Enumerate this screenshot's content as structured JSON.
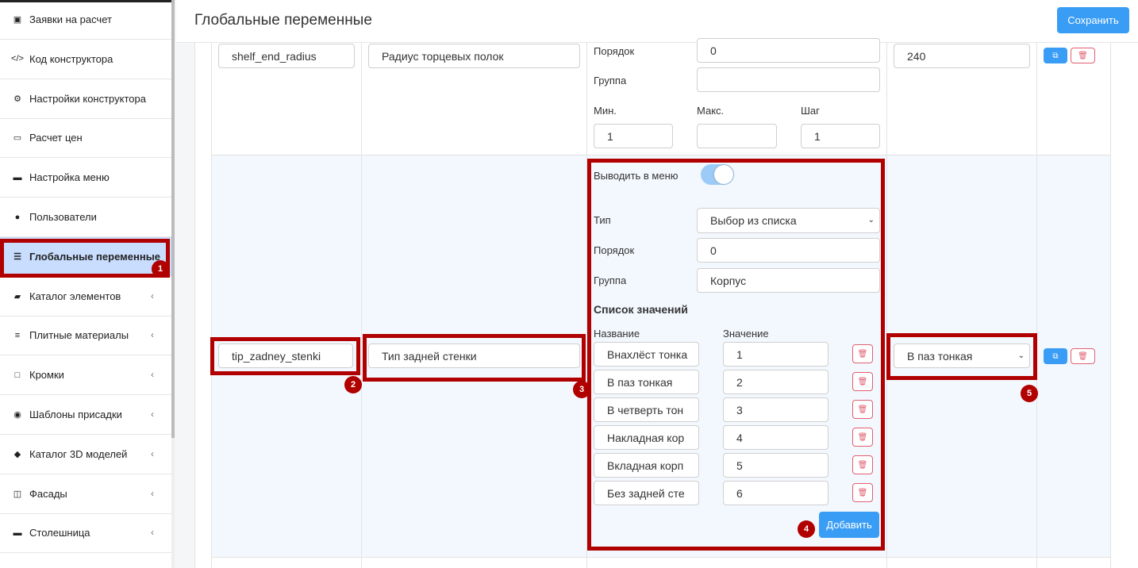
{
  "sidebar": {
    "items": [
      {
        "label": "Заявки на расчет",
        "icon": "clipboard-icon"
      },
      {
        "label": "Код конструктора",
        "icon": "code-icon"
      },
      {
        "label": "Настройки конструктора",
        "icon": "gears-icon"
      },
      {
        "label": "Расчет цен",
        "icon": "money-icon"
      },
      {
        "label": "Настройка меню",
        "icon": "monitor-icon"
      },
      {
        "label": "Пользователи",
        "icon": "user-icon"
      },
      {
        "label": "Глобальные переменные",
        "icon": "list-icon",
        "active": true
      },
      {
        "label": "Каталог элементов",
        "icon": "book-icon",
        "chevron": "‹"
      },
      {
        "label": "Плитные материалы",
        "icon": "bars-icon",
        "chevron": "‹"
      },
      {
        "label": "Кромки",
        "icon": "square-icon",
        "chevron": "‹"
      },
      {
        "label": "Шаблоны присадки",
        "icon": "circle-dot-icon",
        "chevron": "‹"
      },
      {
        "label": "Каталог 3D моделей",
        "icon": "cube-icon",
        "chevron": "‹"
      },
      {
        "label": "Фасады",
        "icon": "columns-icon",
        "chevron": "‹"
      },
      {
        "label": "Столешница",
        "icon": "minus-square-icon",
        "chevron": "‹"
      }
    ]
  },
  "header": {
    "title": "Глобальные переменные",
    "save_label": "Сохранить"
  },
  "row1": {
    "key": "shelf_end_radius",
    "name": "Радиус торцевых полок",
    "order_label": "Порядок",
    "order_value": "0",
    "group_label": "Группа",
    "group_value": "",
    "min_label": "Мин.",
    "max_label": "Макс.",
    "step_label": "Шаг",
    "min_value": "1",
    "max_value": "",
    "step_value": "1",
    "default_value": "240"
  },
  "row2": {
    "key": "tip_zadney_stenki",
    "name": "Тип задней стенки",
    "show_in_menu_label": "Выводить в меню",
    "show_in_menu": true,
    "type_label": "Тип",
    "type_value": "Выбор из списка",
    "order_label": "Порядок",
    "order_value": "0",
    "group_label": "Группа",
    "group_value": "Корпус",
    "values_section_label": "Список значений",
    "col_name_label": "Название",
    "col_value_label": "Значение",
    "options": [
      {
        "name": "Внахлёст тонка",
        "value": "1"
      },
      {
        "name": "В паз тонкая",
        "value": "2"
      },
      {
        "name": "В четверть тон",
        "value": "3"
      },
      {
        "name": "Накладная кор",
        "value": "4"
      },
      {
        "name": "Вкладная корп",
        "value": "5"
      },
      {
        "name": "Без задней сте",
        "value": "6"
      }
    ],
    "add_label": "Добавить",
    "default_value": "В паз тонкая"
  },
  "annotations": [
    "1",
    "2",
    "3",
    "4",
    "5"
  ],
  "colors": {
    "accent": "#3a9df5",
    "annotation": "#b00000",
    "active_sidebar": "#c9ddff",
    "delete": "#e06070"
  }
}
